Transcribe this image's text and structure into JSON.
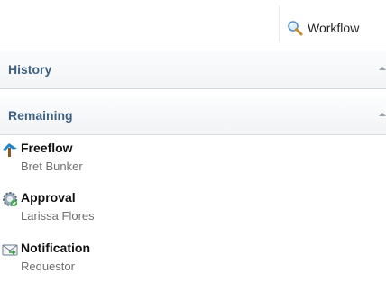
{
  "toolbar": {
    "workflow_label": "Workflow",
    "workflow_icon": "magnifier-icon"
  },
  "sections": {
    "history": {
      "title": "History",
      "state": "collapsed"
    },
    "remaining": {
      "title": "Remaining",
      "state": "collapsed"
    }
  },
  "items": [
    {
      "name": "Freeflow",
      "assignee": "Bret Bunker",
      "icon": "freeflow-arrow-icon"
    },
    {
      "name": "Approval",
      "assignee": "Larissa Flores",
      "icon": "approval-gear-icon"
    },
    {
      "name": "Notification",
      "assignee": "Requestor",
      "icon": "notification-envelope-icon"
    }
  ],
  "colors": {
    "section_title": "#3f607f",
    "item_subtext": "#707070"
  }
}
